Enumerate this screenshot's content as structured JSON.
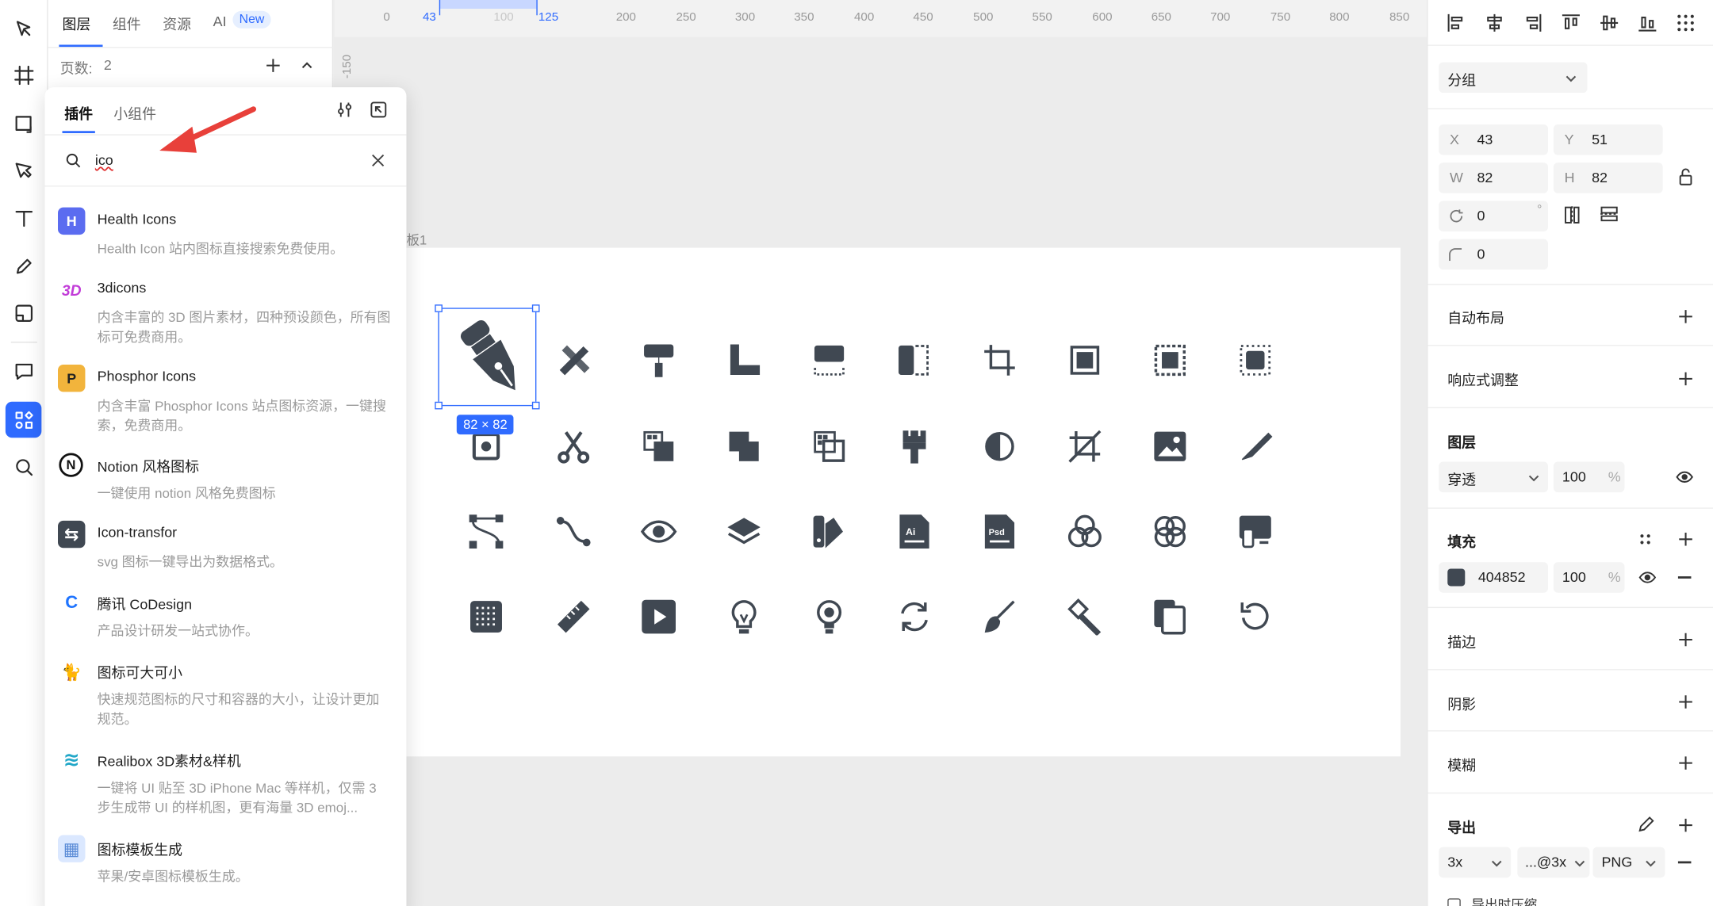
{
  "layers_panel": {
    "tabs": [
      "图层",
      "组件",
      "资源",
      "AI"
    ],
    "new_badge": "New",
    "page_count_label": "页数:",
    "page_count": "2"
  },
  "plugin_popup": {
    "tabs": [
      "插件",
      "小组件"
    ],
    "search_value": "ico",
    "items": [
      {
        "name": "Health Icons",
        "desc": "Health Icon 站内图标直接搜索免费使用。",
        "color": "#5b6cf0",
        "glyph": "H"
      },
      {
        "name": "3dicons",
        "desc": "内含丰富的 3D 图片素材，四种预设颜色，所有图标可免费商用。",
        "color": "#c23cd8",
        "glyph": "3D"
      },
      {
        "name": "Phosphor Icons",
        "desc": "内含丰富 Phosphor Icons 站点图标资源，一键搜索，免费商用。",
        "color": "#f2b43c",
        "glyph": "P"
      },
      {
        "name": "Notion 风格图标",
        "desc": "一键使用 notion 风格免费图标",
        "color": "#ffffff",
        "glyph": "N"
      },
      {
        "name": "Icon-transfor",
        "desc": "svg 图标一键导出为数据格式。",
        "color": "#404852",
        "glyph": "⇆"
      },
      {
        "name": "腾讯 CoDesign",
        "desc": "产品设计研发一站式协作。",
        "color": "#1f74ff",
        "glyph": "C"
      },
      {
        "name": "图标可大可小",
        "desc": "快速规范图标的尺寸和容器的大小，让设计更加规范。",
        "color": "#ffffff",
        "glyph": "🐈"
      },
      {
        "name": "Realibox 3D素材&样机",
        "desc": "一键将 UI 贴至 3D iPhone Mac 等样机，仅需 3 步生成带 UI 的样机图，更有海量 3D emoj...",
        "color": "#22a7c8",
        "glyph": "≋"
      },
      {
        "name": "图标模板生成",
        "desc": "苹果/安卓图标模板生成。",
        "color": "#dbe8ff",
        "glyph": "▦"
      }
    ]
  },
  "ruler": {
    "ticks": [
      "0",
      "43",
      "100",
      "125",
      "200",
      "250",
      "300",
      "350",
      "400",
      "450",
      "500",
      "550",
      "600",
      "650",
      "700",
      "750",
      "800",
      "850"
    ],
    "vertical_tick": "-150"
  },
  "canvas": {
    "frame_label": "板1",
    "selection_size": "82 × 82",
    "icon_names": [
      [
        "pen-nib-icon",
        "ruler-pencil-icon",
        "paint-roller-icon",
        "corner-ruler-icon",
        "align-top-dashed-icon",
        "split-vertical-icon",
        "crop-icon",
        "frame-select-icon",
        "dotted-frame-icon",
        "dotted-frame-alt-icon"
      ],
      [
        "fill-bucket-icon",
        "scissors-icon",
        "mosaic-icon",
        "overlap-squares-icon",
        "mosaic-square-icon",
        "brush-icon",
        "contrast-icon",
        "crop-off-icon",
        "image-icon",
        "knife-icon"
      ],
      [
        "bezier-path-icon",
        "curve-path-icon",
        "eye-icon",
        "layers-icon",
        "color-swatch-icon",
        "ai-file-icon",
        "psd-file-icon",
        "color-circles-icon",
        "four-circles-icon",
        "devices-icon"
      ],
      [
        "grid-tile-icon",
        "ruler-icon",
        "play-icon",
        "lightbulb-icon",
        "lightbulb-alt-icon",
        "sync-icon",
        "pen-tool-icon",
        "hammer-icon",
        "copy-icon",
        "rotate-icon"
      ]
    ]
  },
  "properties": {
    "group_select": "分组",
    "x_label": "X",
    "x": "43",
    "y_label": "Y",
    "y": "51",
    "w_label": "W",
    "w": "82",
    "h_label": "H",
    "h": "82",
    "rotation": "0",
    "degree_mark": "°",
    "radius": "0",
    "auto_layout": "自动布局",
    "responsive": "响应式调整",
    "layer": "图层",
    "blend_mode": "穿透",
    "layer_opacity": "100",
    "percent": "%",
    "fill": "填充",
    "fill_hex": "404852",
    "fill_opacity": "100",
    "fill_color": "#404852",
    "stroke": "描边",
    "shadow": "阴影",
    "blur": "模糊",
    "export": "导出",
    "export_scale": "3x",
    "export_suffix": "...@3x",
    "export_format": "PNG",
    "export_compress": "导出时压缩"
  }
}
